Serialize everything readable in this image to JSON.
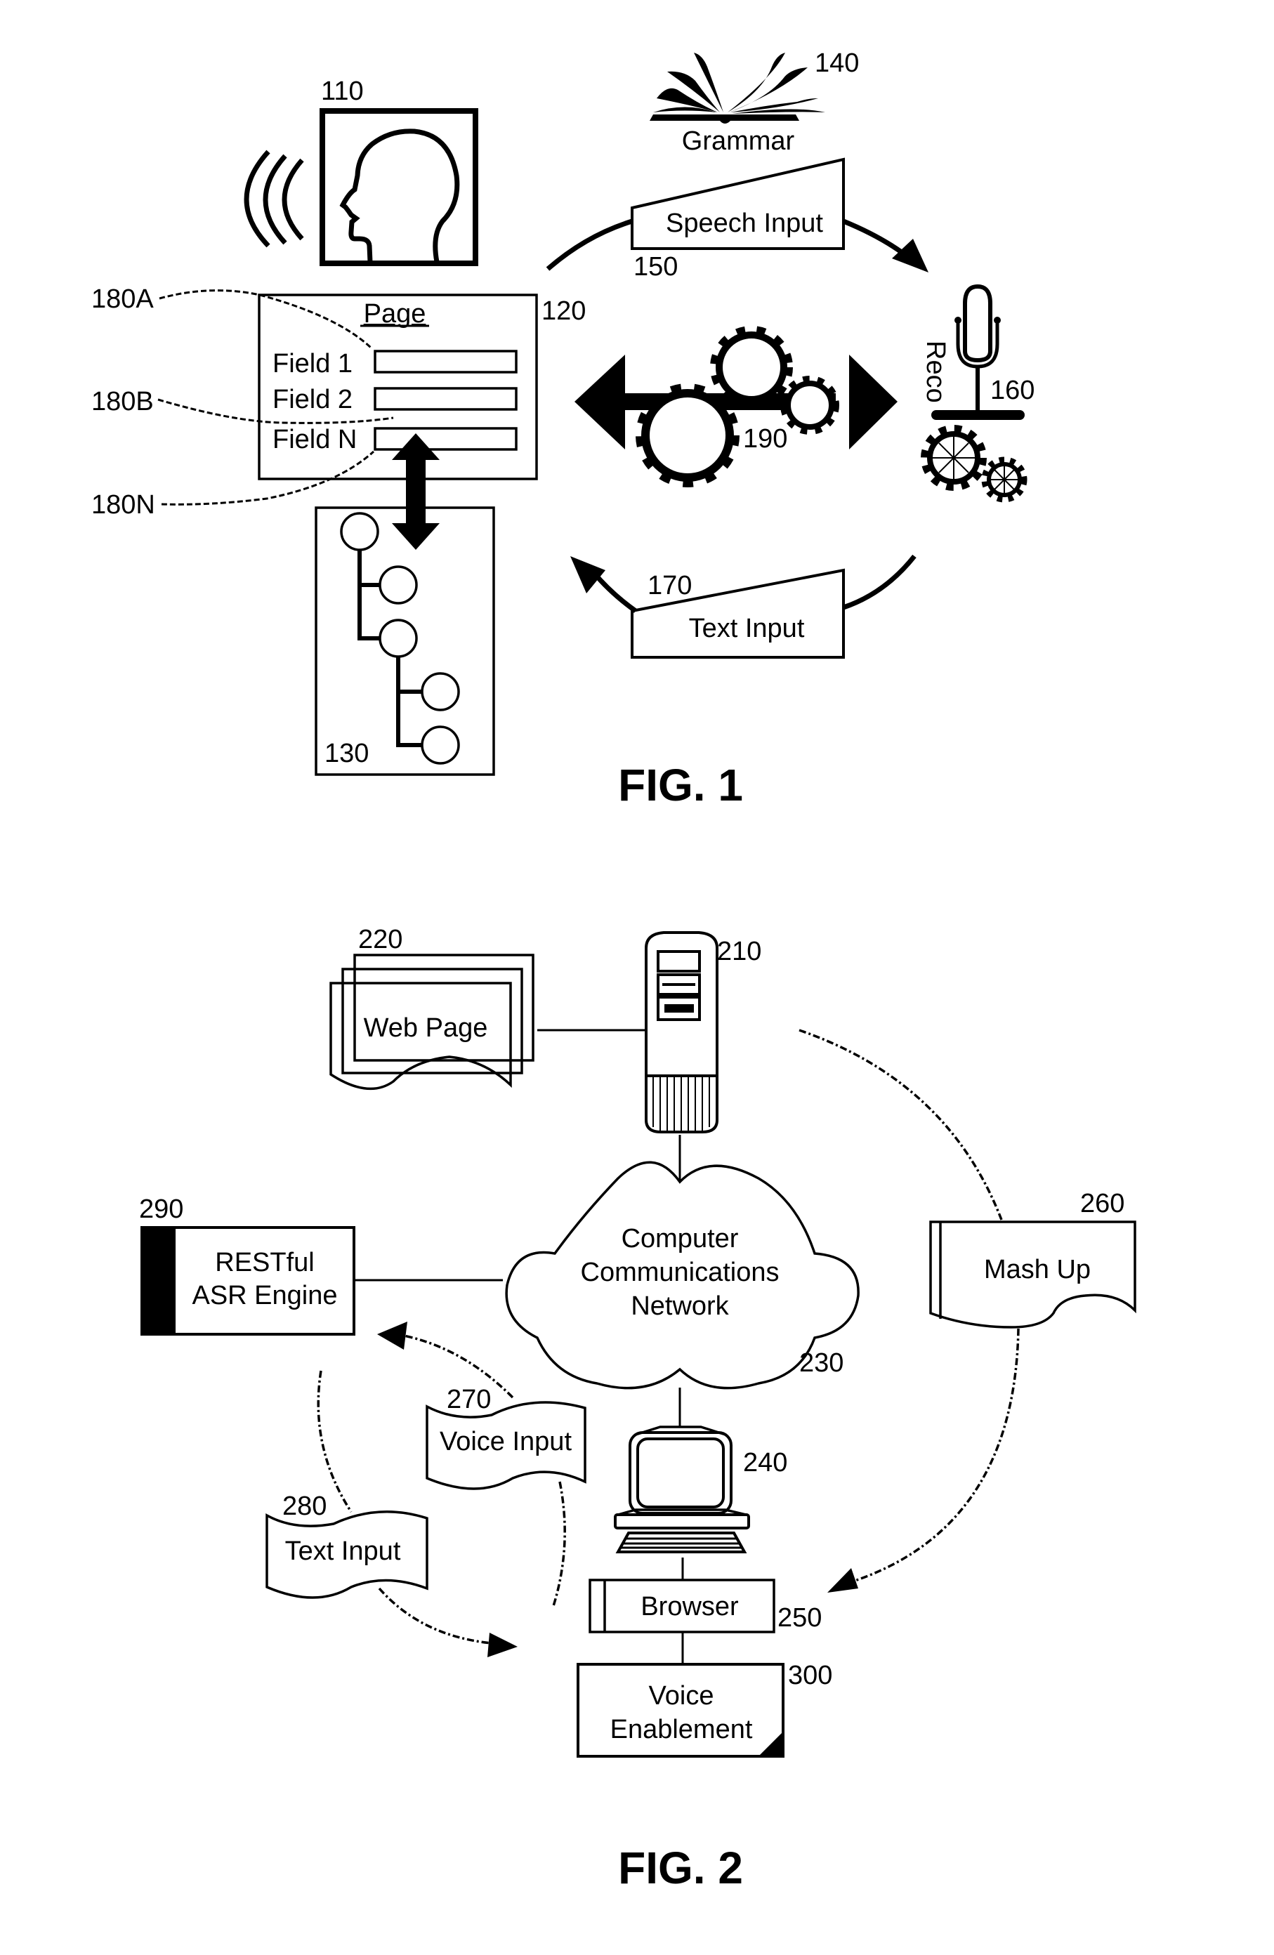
{
  "figure1": {
    "title": "FIG. 1",
    "user": {
      "ref": "110",
      "icon": "speaking-head-icon"
    },
    "grammar": {
      "ref": "140",
      "label": "Grammar",
      "icon": "open-book-icon"
    },
    "speech_input": {
      "ref": "150",
      "label": "Speech Input"
    },
    "page": {
      "ref": "120",
      "title": "Page",
      "fields": [
        {
          "label": "Field 1",
          "ref": "180A"
        },
        {
          "label": "Field 2",
          "ref": "180B"
        },
        {
          "label": "Field N",
          "ref": "180N"
        }
      ]
    },
    "dom_tree": {
      "ref": "130",
      "icon": "tree-icon"
    },
    "processing": {
      "ref": "190",
      "icon": "gears-double-arrow-icon"
    },
    "recognizer": {
      "ref": "160",
      "label": "Reco",
      "icon": "microphone-icon"
    },
    "text_input": {
      "ref": "170",
      "label": "Text Input"
    }
  },
  "figure2": {
    "title": "FIG. 2",
    "server": {
      "ref": "210",
      "icon": "server-tower-icon"
    },
    "web_page": {
      "ref": "220",
      "label": "Web Page"
    },
    "network": {
      "ref": "230",
      "label_lines": [
        "Computer",
        "Communications",
        "Network"
      ]
    },
    "client": {
      "ref": "240",
      "icon": "desktop-computer-icon"
    },
    "browser": {
      "ref": "250",
      "label": "Browser"
    },
    "mash_up": {
      "ref": "260",
      "label": "Mash Up"
    },
    "voice_input": {
      "ref": "270",
      "label": "Voice Input"
    },
    "text_input": {
      "ref": "280",
      "label": "Text Input"
    },
    "asr_engine": {
      "ref": "290",
      "label_lines": [
        "RESTful",
        "ASR Engine"
      ]
    },
    "voice_enablement": {
      "ref": "300",
      "label_lines": [
        "Voice",
        "Enablement"
      ]
    }
  }
}
